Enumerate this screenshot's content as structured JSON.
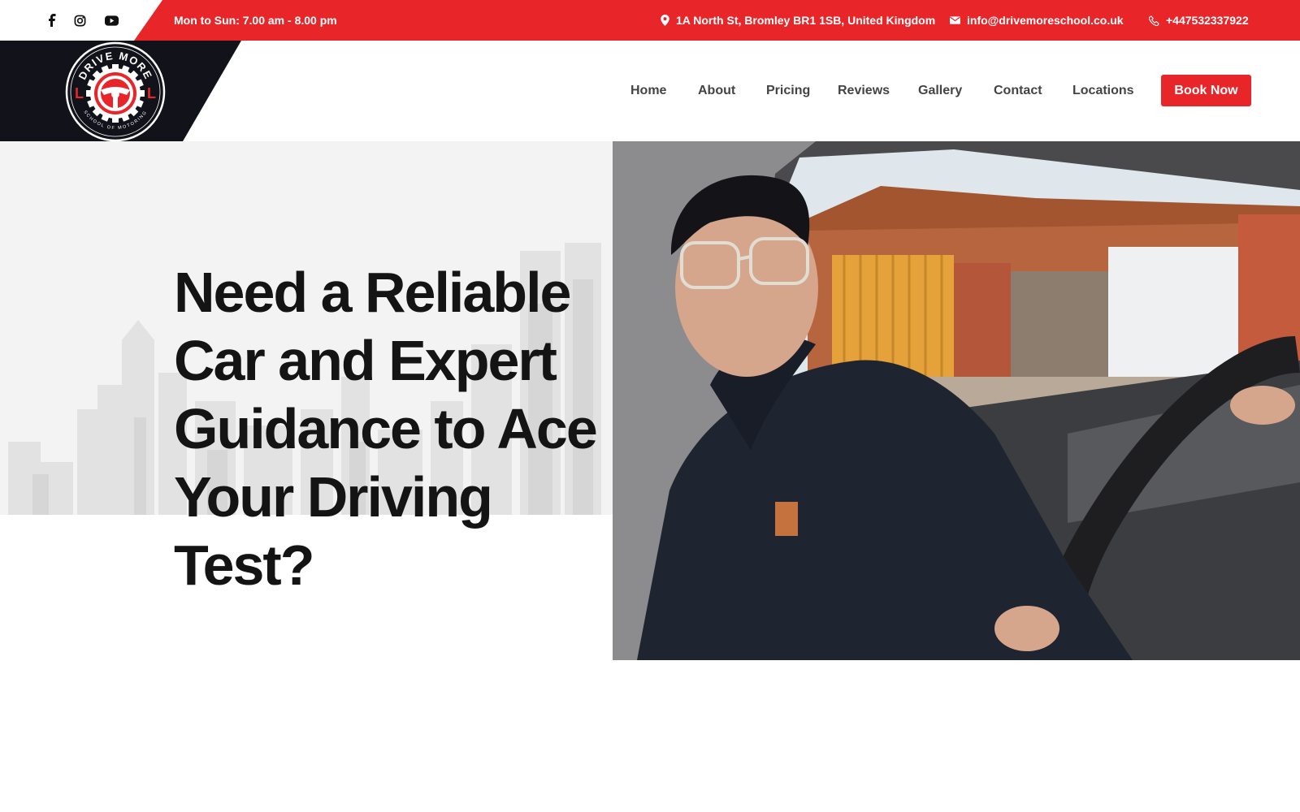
{
  "topbar": {
    "social": [
      {
        "name": "facebook-icon"
      },
      {
        "name": "instagram-icon"
      },
      {
        "name": "youtube-icon"
      }
    ],
    "hours": "Mon to Sun: 7.00 am - 8.00 pm",
    "address": "1A North St, Bromley BR1 1SB, United Kingdom",
    "email": "info@drivemoreschool.co.uk",
    "phone": "+447532337922",
    "accent_color": "#e8262a"
  },
  "logo": {
    "top_text": "DRIVE MORE",
    "bottom_text": "SCHOOL OF MOTORING",
    "left_letter": "L",
    "right_letter": "L"
  },
  "nav": {
    "items": [
      {
        "label": "Home"
      },
      {
        "label": "About"
      },
      {
        "label": "Pricing"
      },
      {
        "label": "Reviews"
      },
      {
        "label": "Gallery"
      },
      {
        "label": "Contact"
      },
      {
        "label": "Locations"
      }
    ],
    "cta_label": "Book Now"
  },
  "hero": {
    "title": "Need a Reliable Car and Expert Guidance to Ace Your Driving Test?"
  }
}
